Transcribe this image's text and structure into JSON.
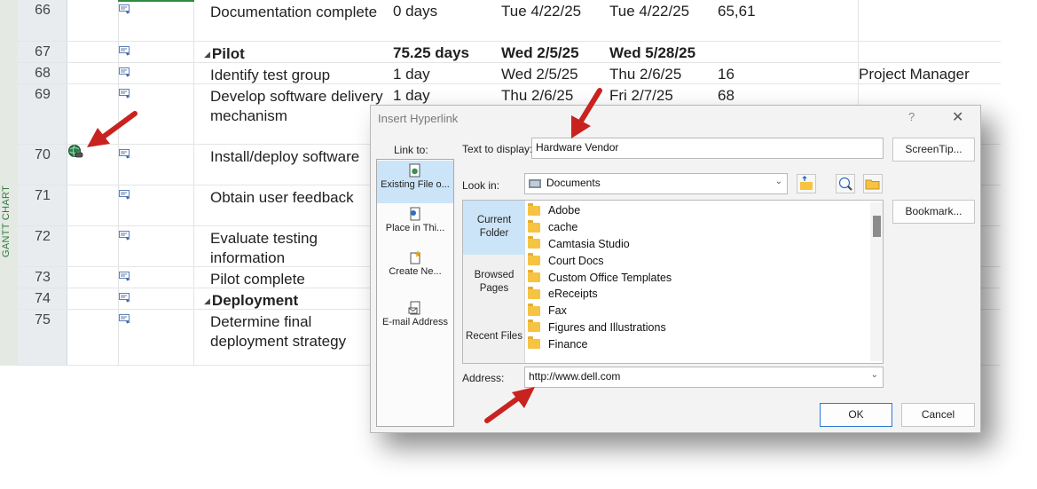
{
  "sheet": {
    "side_label": "GANTT CHART",
    "rows": [
      {
        "id": "66",
        "name": "Documentation complete",
        "duration": "0 days",
        "start": "Tue 4/22/25",
        "finish": "Tue 4/22/25",
        "pred": "65,61",
        "resource": "",
        "summary": false
      },
      {
        "id": "67",
        "name": "Pilot",
        "duration": "75.25 days",
        "start": "Wed 2/5/25",
        "finish": "Wed 5/28/25",
        "pred": "",
        "resource": "",
        "summary": true
      },
      {
        "id": "68",
        "name": "Identify test group",
        "duration": "1 day",
        "start": "Wed 2/5/25",
        "finish": "Thu 2/6/25",
        "pred": "16",
        "resource": "Project Manager",
        "summary": false
      },
      {
        "id": "69",
        "name": "Develop software delivery mechanism",
        "duration": "1 day",
        "start": "Thu 2/6/25",
        "finish": "Fri 2/7/25",
        "pred": "68",
        "resource": "",
        "summary": false
      },
      {
        "id": "70",
        "name": "Install/deploy software",
        "duration": "",
        "start": "",
        "finish": "",
        "pred": "",
        "resource": "",
        "summary": false
      },
      {
        "id": "71",
        "name": "Obtain user feedback",
        "duration": "",
        "start": "",
        "finish": "",
        "pred": "",
        "resource": "",
        "summary": false
      },
      {
        "id": "72",
        "name": "Evaluate testing information",
        "duration": "",
        "start": "",
        "finish": "",
        "pred": "",
        "resource": "",
        "summary": false
      },
      {
        "id": "73",
        "name": "Pilot complete",
        "duration": "",
        "start": "",
        "finish": "",
        "pred": "",
        "resource": "",
        "summary": false
      },
      {
        "id": "74",
        "name": "Deployment",
        "duration": "",
        "start": "",
        "finish": "",
        "pred": "",
        "resource": "",
        "summary": true
      },
      {
        "id": "75",
        "name": "Determine final deployment strategy",
        "duration": "",
        "start": "",
        "finish": "",
        "pred": "",
        "resource": "",
        "summary": false
      }
    ]
  },
  "dialog": {
    "title": "Insert Hyperlink",
    "help": "?",
    "close": "✕",
    "link_to_label": "Link to:",
    "link_items": [
      "Existing File o...",
      "Place in Thi...",
      "Create Ne...",
      "E-mail Address"
    ],
    "text_to_display_label": "Text to display:",
    "text_to_display_value": "Hardware Vendor",
    "screentip_label": "ScreenTip...",
    "look_in_label": "Look in:",
    "look_in_value": "Documents",
    "bookmark_label": "Bookmark...",
    "side_tabs": [
      "Current Folder",
      "Browsed Pages",
      "Recent Files"
    ],
    "files": [
      "Adobe",
      "cache",
      "Camtasia Studio",
      "Court Docs",
      "Custom Office Templates",
      "eReceipts",
      "Fax",
      "Figures and Illustrations",
      "Finance"
    ],
    "address_label": "Address:",
    "address_value": "http://www.dell.com",
    "ok_label": "OK",
    "cancel_label": "Cancel"
  },
  "colors": {
    "accent_blue": "#cce4f7",
    "arrow_red": "#c8231f",
    "gantt_green": "#2e8b3e"
  }
}
